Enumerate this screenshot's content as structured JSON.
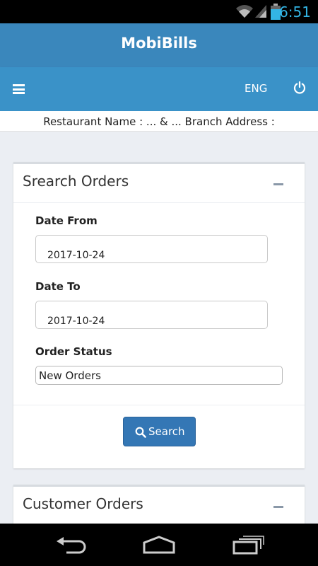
{
  "status_bar": {
    "time": "6:51"
  },
  "app": {
    "title": "MobiBills"
  },
  "nav": {
    "language": "ENG"
  },
  "restaurant_bar": {
    "text": "Restaurant Name  :  ... & ... Branch Address  :"
  },
  "search_card": {
    "title": "Srearch Orders",
    "date_from_label": "Date From",
    "date_from_value": "2017-10-24",
    "date_to_label": "Date To",
    "date_to_value": "2017-10-24",
    "order_status_label": "Order Status",
    "order_status_value": "New Orders",
    "search_button": "Search"
  },
  "customer_card": {
    "title": "Customer Orders"
  }
}
